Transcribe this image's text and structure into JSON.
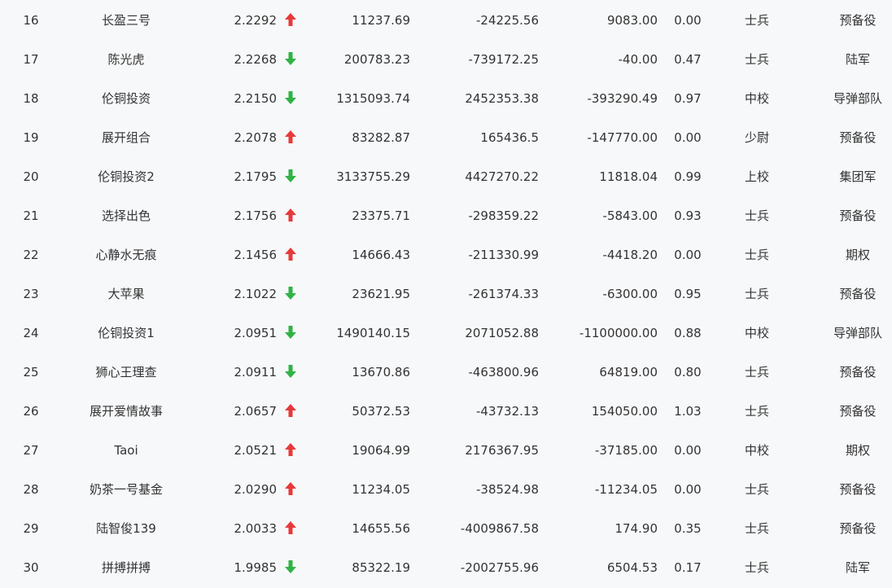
{
  "colors": {
    "up": "#e8393a",
    "down": "#2fb344",
    "text": "#333333",
    "background": "#f7f8fa"
  },
  "rows": [
    {
      "rank": "16",
      "name": "长盈三号",
      "nav": "2.2292",
      "trend": "up",
      "v1": "11237.69",
      "v2": "-24225.56",
      "v3": "9083.00",
      "ratio": "0.00",
      "grade": "士兵",
      "army": "预备役"
    },
    {
      "rank": "17",
      "name": "陈光虎",
      "nav": "2.2268",
      "trend": "down",
      "v1": "200783.23",
      "v2": "-739172.25",
      "v3": "-40.00",
      "ratio": "0.47",
      "grade": "士兵",
      "army": "陆军"
    },
    {
      "rank": "18",
      "name": "伦铜投资",
      "nav": "2.2150",
      "trend": "down",
      "v1": "1315093.74",
      "v2": "2452353.38",
      "v3": "-393290.49",
      "ratio": "0.97",
      "grade": "中校",
      "army": "导弹部队"
    },
    {
      "rank": "19",
      "name": "展开组合",
      "nav": "2.2078",
      "trend": "up",
      "v1": "83282.87",
      "v2": "165436.5",
      "v3": "-147770.00",
      "ratio": "0.00",
      "grade": "少尉",
      "army": "预备役"
    },
    {
      "rank": "20",
      "name": "伦铜投资2",
      "nav": "2.1795",
      "trend": "down",
      "v1": "3133755.29",
      "v2": "4427270.22",
      "v3": "11818.04",
      "ratio": "0.99",
      "grade": "上校",
      "army": "集团军"
    },
    {
      "rank": "21",
      "name": "选择出色",
      "nav": "2.1756",
      "trend": "up",
      "v1": "23375.71",
      "v2": "-298359.22",
      "v3": "-5843.00",
      "ratio": "0.93",
      "grade": "士兵",
      "army": "预备役"
    },
    {
      "rank": "22",
      "name": "心静水无痕",
      "nav": "2.1456",
      "trend": "up",
      "v1": "14666.43",
      "v2": "-211330.99",
      "v3": "-4418.20",
      "ratio": "0.00",
      "grade": "士兵",
      "army": "期权"
    },
    {
      "rank": "23",
      "name": "大苹果",
      "nav": "2.1022",
      "trend": "down",
      "v1": "23621.95",
      "v2": "-261374.33",
      "v3": "-6300.00",
      "ratio": "0.95",
      "grade": "士兵",
      "army": "预备役"
    },
    {
      "rank": "24",
      "name": "伦铜投资1",
      "nav": "2.0951",
      "trend": "down",
      "v1": "1490140.15",
      "v2": "2071052.88",
      "v3": "-1100000.00",
      "ratio": "0.88",
      "grade": "中校",
      "army": "导弹部队"
    },
    {
      "rank": "25",
      "name": "狮心王理查",
      "nav": "2.0911",
      "trend": "down",
      "v1": "13670.86",
      "v2": "-463800.96",
      "v3": "64819.00",
      "ratio": "0.80",
      "grade": "士兵",
      "army": "预备役"
    },
    {
      "rank": "26",
      "name": "展开爱情故事",
      "nav": "2.0657",
      "trend": "up",
      "v1": "50372.53",
      "v2": "-43732.13",
      "v3": "154050.00",
      "ratio": "1.03",
      "grade": "士兵",
      "army": "预备役"
    },
    {
      "rank": "27",
      "name": "Taoi",
      "nav": "2.0521",
      "trend": "up",
      "v1": "19064.99",
      "v2": "2176367.95",
      "v3": "-37185.00",
      "ratio": "0.00",
      "grade": "中校",
      "army": "期权"
    },
    {
      "rank": "28",
      "name": "奶茶一号基金",
      "nav": "2.0290",
      "trend": "up",
      "v1": "11234.05",
      "v2": "-38524.98",
      "v3": "-11234.05",
      "ratio": "0.00",
      "grade": "士兵",
      "army": "预备役"
    },
    {
      "rank": "29",
      "name": "陆智俊139",
      "nav": "2.0033",
      "trend": "up",
      "v1": "14655.56",
      "v2": "-4009867.58",
      "v3": "174.90",
      "ratio": "0.35",
      "grade": "士兵",
      "army": "预备役"
    },
    {
      "rank": "30",
      "name": "拼搏拼搏",
      "nav": "1.9985",
      "trend": "down",
      "v1": "85322.19",
      "v2": "-2002755.96",
      "v3": "6504.53",
      "ratio": "0.17",
      "grade": "士兵",
      "army": "陆军"
    }
  ]
}
